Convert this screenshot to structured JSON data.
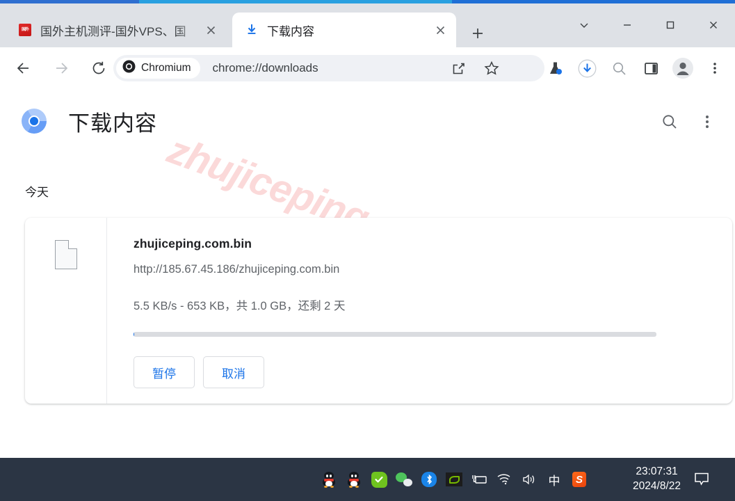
{
  "browser": {
    "tabs": [
      {
        "title": "国外主机测评-国外VPS、国",
        "favicon": "red-seal-favicon",
        "active": false,
        "close_label": "×"
      },
      {
        "title": "下载内容",
        "favicon": "download-arrow-icon",
        "active": true,
        "close_label": "×"
      }
    ],
    "new_tab_label": "+",
    "window_controls": {
      "tab_search": "tab-search-chevron",
      "minimize": "minimize",
      "maximize": "maximize",
      "close": "close"
    },
    "toolbar": {
      "back": "back-arrow",
      "forward": "forward-arrow",
      "reload": "reload",
      "chip_label": "Chromium",
      "url": "chrome://downloads",
      "share": "share-icon",
      "bookmark": "star-icon",
      "experiments": "flask-icon",
      "downloads": "downloads-icon",
      "search": "search-icon",
      "side_panel": "side-panel-icon",
      "profile": "profile-avatar",
      "menu": "three-dot-menu"
    }
  },
  "page": {
    "title": "下载内容",
    "logo": "chromium-logo",
    "search_label": "search-icon",
    "menu_label": "three-dot-menu",
    "date_group": "今天",
    "watermark": "zhujiceping.com",
    "download": {
      "file_icon": "generic-file-icon",
      "name": "zhujiceping.com.bin",
      "url": "http://185.67.45.186/zhujiceping.com.bin",
      "status": "5.5 KB/s - 653 KB，共 1.0 GB，还剩 2 天",
      "progress_percent": 0.06,
      "pause_label": "暂停",
      "cancel_label": "取消"
    }
  },
  "taskbar": {
    "tray": [
      {
        "name": "qq-icon",
        "glyph": "penguin"
      },
      {
        "name": "qq-icon-2",
        "glyph": "penguin"
      },
      {
        "name": "green-check-icon",
        "glyph": "check"
      },
      {
        "name": "wechat-icon",
        "glyph": "wechat"
      },
      {
        "name": "bluetooth-icon",
        "glyph": "bluetooth"
      },
      {
        "name": "nvidia-icon",
        "glyph": "nvidia"
      },
      {
        "name": "battery-icon",
        "glyph": "battery"
      },
      {
        "name": "wifi-icon",
        "glyph": "wifi"
      },
      {
        "name": "volume-icon",
        "glyph": "volume"
      },
      {
        "name": "ime-icon",
        "glyph": "中"
      },
      {
        "name": "sogou-icon",
        "glyph": "S"
      }
    ],
    "time": "23:07:31",
    "date": "2024/8/22",
    "notification": "notification-balloon"
  },
  "colors": {
    "accent": "#1a73e8",
    "tabstrip_bg": "#dee1e6",
    "taskbar_bg": "#2b3544",
    "watermark": "#fbd9d9"
  }
}
